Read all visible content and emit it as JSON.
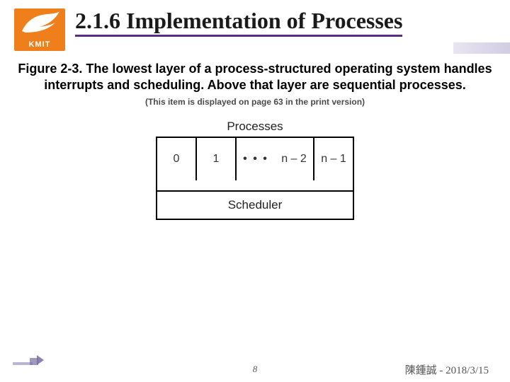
{
  "logo": {
    "text": "KMIT"
  },
  "title": "2.1.6 Implementation of Processes",
  "figure": {
    "caption": "Figure 2-3. The lowest layer of a process-structured operating system handles interrupts and scheduling. Above that layer are sequential processes.",
    "print_note": "(This item is displayed on page 63 in the print version)"
  },
  "diagram": {
    "top_label": "Processes",
    "cells": {
      "c0": "0",
      "c1": "1",
      "dots": "• • •",
      "cN2": "n – 2",
      "cN1": "n – 1"
    },
    "scheduler": "Scheduler"
  },
  "footer": {
    "page": "8",
    "author_date": "陳鍾誠 - 2018/3/15"
  }
}
